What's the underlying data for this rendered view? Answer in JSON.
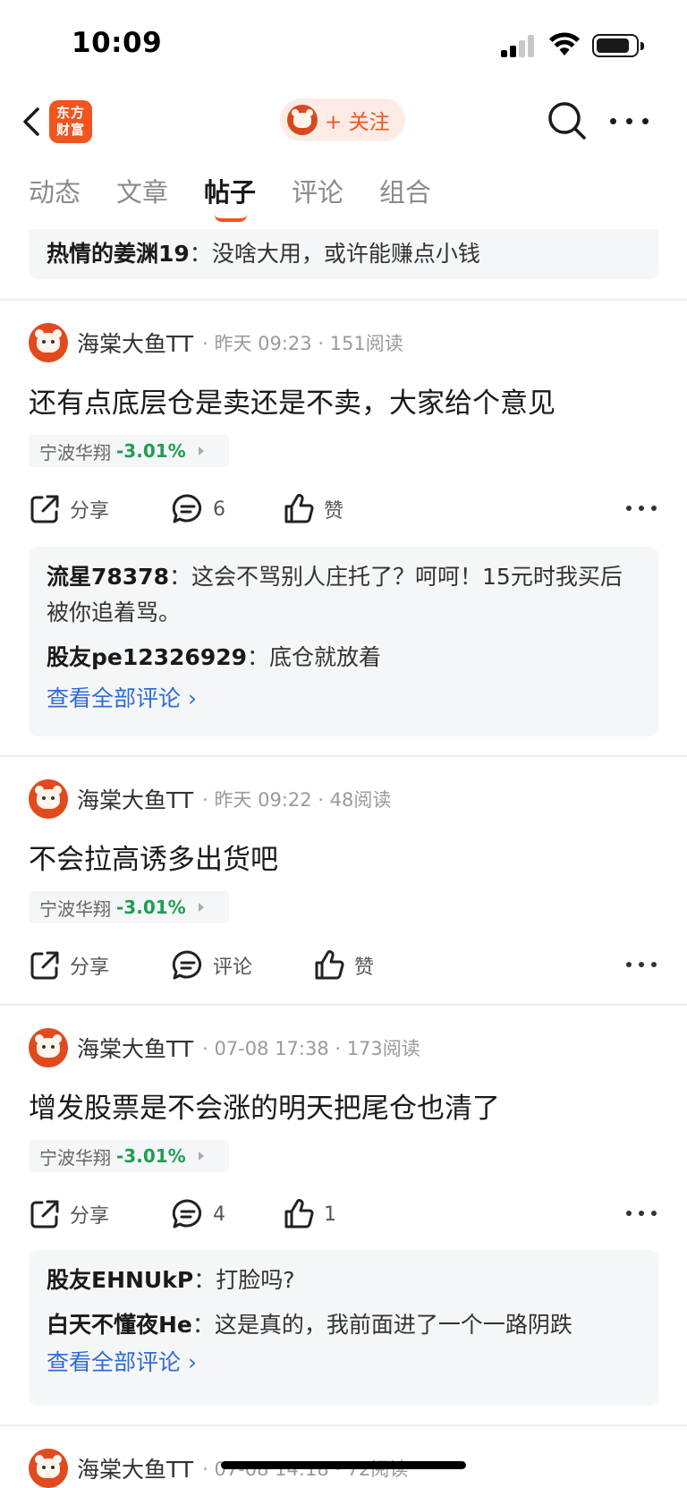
{
  "status_bar": {
    "time": "10:09"
  },
  "nav": {
    "logo_text_line1": "东方",
    "logo_text_line2": "财富",
    "follow_label": "+ 关注"
  },
  "tabs": [
    {
      "label": "动态"
    },
    {
      "label": "文章"
    },
    {
      "label": "帖子"
    },
    {
      "label": "评论"
    },
    {
      "label": "组合"
    }
  ],
  "top_partial_comment": {
    "user": "热情的姜渊19",
    "sep": "：",
    "text": "没啥大用，或许能赚点小钱"
  },
  "posts": [
    {
      "author": "海棠大鱼TT",
      "meta": "· 昨天 09:23 · 151阅读",
      "title": "还有点底层仓是卖还是不卖，大家给个意见",
      "stock_name": "宁波华翔",
      "stock_change": "-3.01%",
      "share_label": "分享",
      "comment_label": "6",
      "like_label": "赞",
      "comments": [
        {
          "user": "流星78378",
          "sep": "：",
          "text": "这会不骂别人庄托了？呵呵！15元时我买后被你追着骂。"
        },
        {
          "user": "股友pe12326929",
          "sep": "：",
          "text": "底仓就放着"
        }
      ],
      "see_all": "查看全部评论 ›"
    },
    {
      "author": "海棠大鱼TT",
      "meta": "· 昨天 09:22 · 48阅读",
      "title": "不会拉高诱多出货吧",
      "stock_name": "宁波华翔",
      "stock_change": "-3.01%",
      "share_label": "分享",
      "comment_label": "评论",
      "like_label": "赞"
    },
    {
      "author": "海棠大鱼TT",
      "meta": "· 07-08 17:38 · 173阅读",
      "title": "增发股票是不会涨的明天把尾仓也清了",
      "stock_name": "宁波华翔",
      "stock_change": "-3.01%",
      "share_label": "分享",
      "comment_label": "4",
      "like_label": "1",
      "comments": [
        {
          "user": "股友EHNUkP",
          "sep": "：",
          "text": "打脸吗?"
        },
        {
          "user": "白天不懂夜He",
          "sep": "：",
          "text": "这是真的，我前面进了一个一路阴跌"
        }
      ],
      "see_all": "查看全部评论 ›"
    },
    {
      "author": "海棠大鱼TT",
      "meta": "· 07-08 14:18 · 72阅读"
    }
  ],
  "colors": {
    "accent": "#f2541f",
    "down_green": "#1e9e52",
    "link_blue": "#2f6bd7"
  }
}
